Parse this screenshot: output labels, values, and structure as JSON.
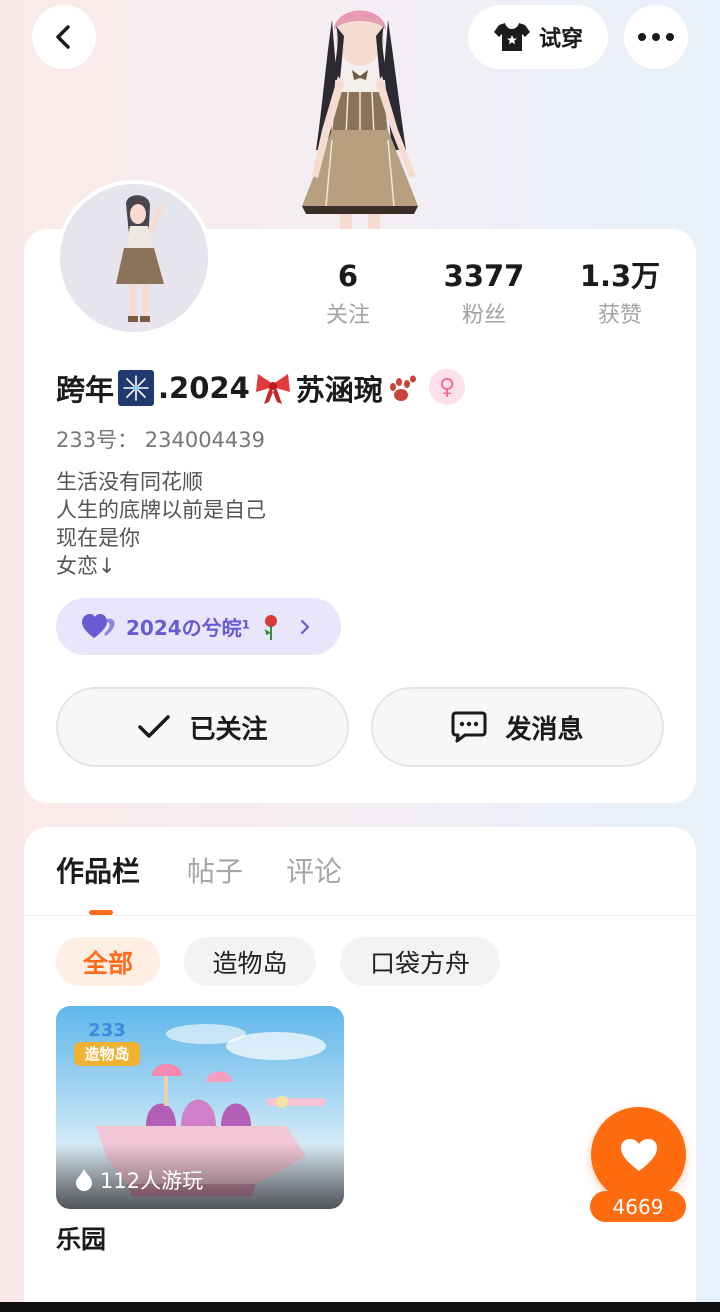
{
  "header": {
    "back_icon": "chevron-left-icon",
    "tryon_label": "试穿",
    "tryon_icon": "shirt-icon",
    "more_icon": "more-dots-icon"
  },
  "profile": {
    "stats": [
      {
        "value": "6",
        "label": "关注"
      },
      {
        "value": "3377",
        "label": "粉丝"
      },
      {
        "value": "1.3万",
        "label": "获赞"
      }
    ],
    "nickname_prefix": "跨年",
    "nickname_mid": ".2024",
    "nickname_suffix": "苏涵琬",
    "gender_symbol": "♀",
    "uid_text": "233号： 234004439",
    "bio": "生活没有同花顺\n人生的底牌以前是自己\n现在是你\n女恋↓",
    "tag_label": "2024の兮皖¹",
    "follow_label": "已关注",
    "message_label": "发消息"
  },
  "works": {
    "tabs": [
      "作品栏",
      "帖子",
      "评论"
    ],
    "active_tab": "作品栏",
    "filters": [
      "全部",
      "造物岛",
      "口袋方舟"
    ],
    "active_filter": "全部",
    "items": [
      {
        "title": "乐园",
        "plays": "112人游玩",
        "badge_top": "233",
        "badge_bottom": "造物岛"
      }
    ]
  },
  "fab": {
    "icon": "heart-icon",
    "count": "4669"
  },
  "colors": {
    "accent": "#ff6b1a",
    "tag_purple": "#6b5bd2",
    "gender_pink": "#ef6a95"
  }
}
